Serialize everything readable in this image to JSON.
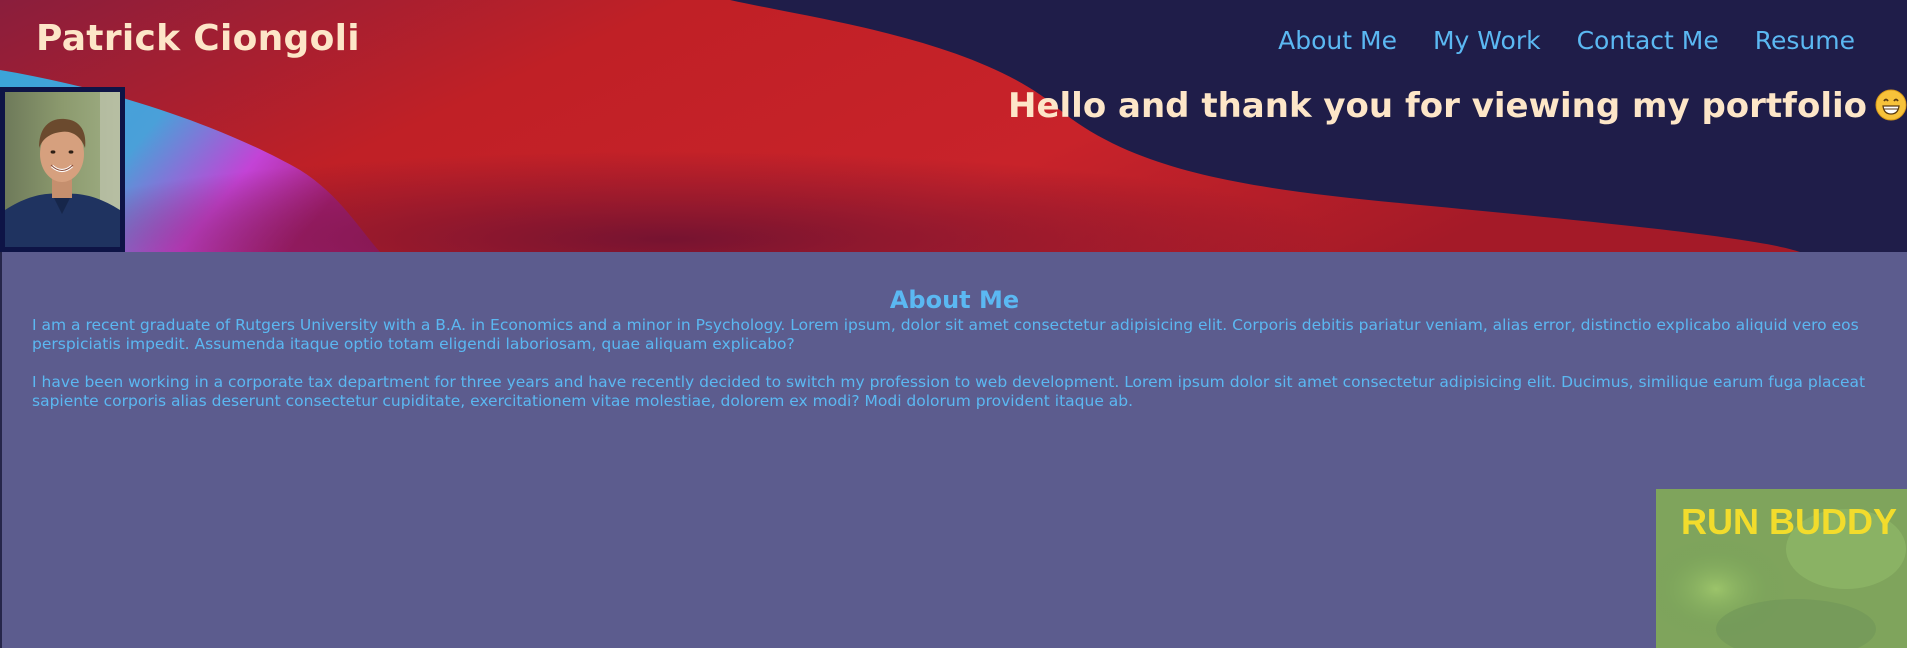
{
  "site": {
    "title": "Patrick Ciongoli",
    "greeting": "Hello and thank you for viewing my portfolio",
    "greeting_emoji": "grinning-face-emoji"
  },
  "nav": {
    "items": [
      {
        "label": "About Me"
      },
      {
        "label": "My Work"
      },
      {
        "label": "Contact Me"
      },
      {
        "label": "Resume"
      }
    ]
  },
  "about": {
    "heading": "About Me",
    "paragraphs": [
      "I am a recent graduate of Rutgers University with a B.A. in Economics and a minor in Psychology. Lorem ipsum, dolor sit amet consectetur adipisicing elit. Corporis debitis pariatur veniam, alias error, distinctio explicabo aliquid vero eos perspiciatis impedit. Assumenda itaque optio totam eligendi laboriosam, quae aliquam explicabo?",
      "I have been working in a corporate tax department for three years and have recently decided to switch my profession to web development. Lorem ipsum dolor sit amet consectetur adipisicing elit. Ducimus, similique earum fuga placeat sapiente corporis alias deserunt consectetur cupiditate, exercitationem vitae molestiae, dolorem ex modi? Modi dolorum provident itaque ab."
    ]
  },
  "work": {
    "projects": [
      {
        "label": "RUN BUDDY"
      }
    ]
  },
  "colors": {
    "background": "#5c5c8e",
    "accent": "#5bb8f2",
    "title": "#fde6c8",
    "hero_dark": "#1f1d49",
    "hero_red": "#c02026",
    "hero_magenta": "#c343d6",
    "hero_blue": "#3ba4d8",
    "project_label": "#f2dc2c"
  }
}
